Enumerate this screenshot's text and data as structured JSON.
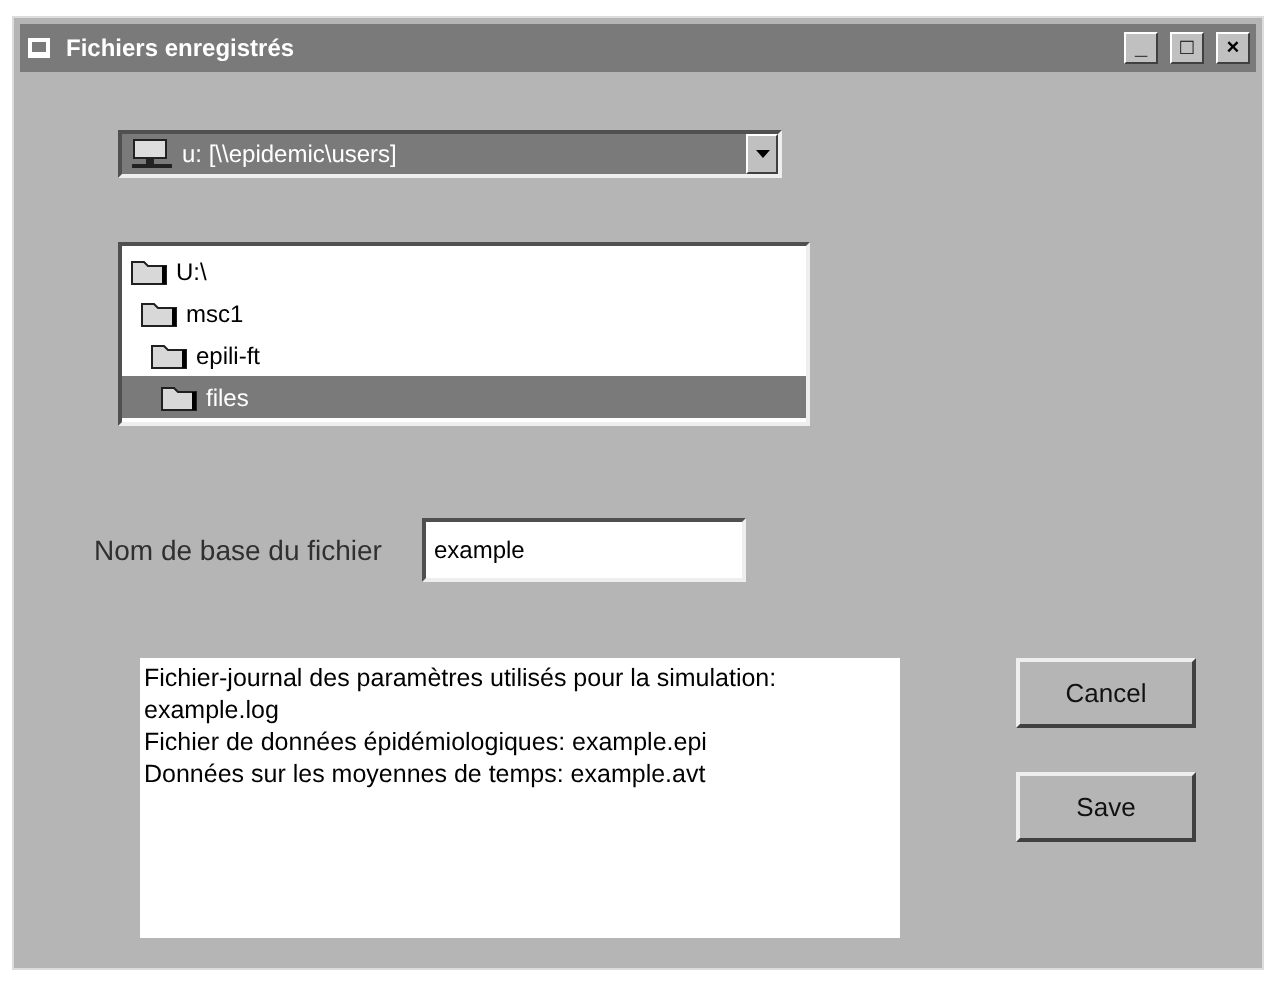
{
  "window": {
    "title": "Fichiers enregistrés",
    "controls": [
      "_",
      "□",
      "×"
    ]
  },
  "drive": {
    "value": "u: [\\\\epidemic\\users]"
  },
  "folders": [
    {
      "label": "U:\\",
      "selected": false,
      "children": [
        {
          "label": "msc1",
          "selected": false,
          "children": [
            {
              "label": "epili-ft",
              "selected": false,
              "children": [
                {
                  "label": "files",
                  "selected": true
                }
              ]
            }
          ]
        }
      ]
    }
  ],
  "base_name": {
    "label": "Nom de base du fichier",
    "value": "example"
  },
  "output_files": [
    "Fichier-journal des paramètres utilisés pour la simulation: example.log",
    "Fichier de données épidémiologiques: example.epi",
    "Données sur les moyennes de temps: example.avt"
  ],
  "buttons": [
    "Cancel",
    "Save"
  ]
}
